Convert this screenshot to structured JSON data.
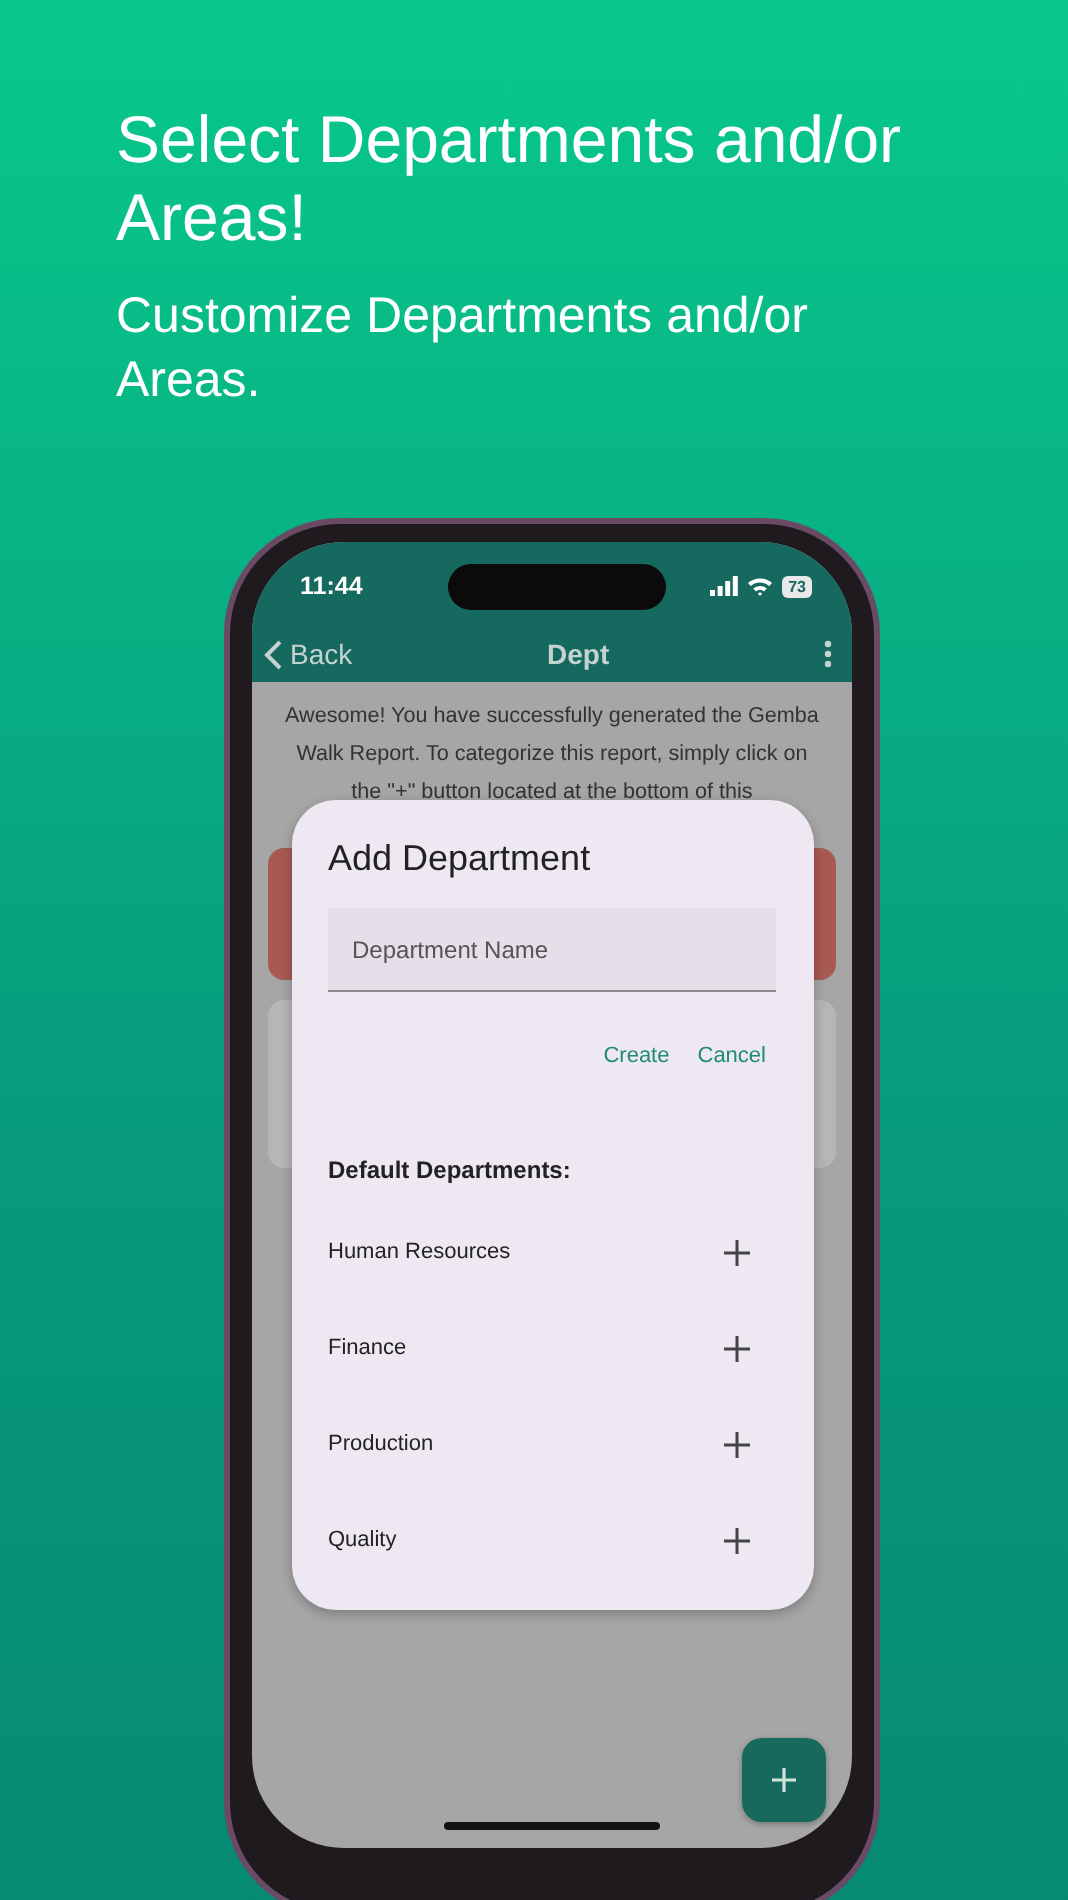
{
  "header": {
    "title": "Select Departments and/or Areas!",
    "subtitle": "Customize Departments and/or Areas."
  },
  "status_bar": {
    "time": "11:44",
    "battery": "73"
  },
  "nav": {
    "back": "Back",
    "title": "Dept"
  },
  "intro": "Awesome! You have successfully generated the Gemba Walk Report. To categorize this report, simply click on the \"+\" button located at the bottom of this",
  "dialog": {
    "title": "Add Department",
    "field": {
      "placeholder": "Department Name"
    },
    "actions": [
      "Create",
      "Cancel"
    ],
    "section": "Default Departments:",
    "departments": [
      "Human Resources",
      "Finance",
      "Production",
      "Quality"
    ]
  }
}
